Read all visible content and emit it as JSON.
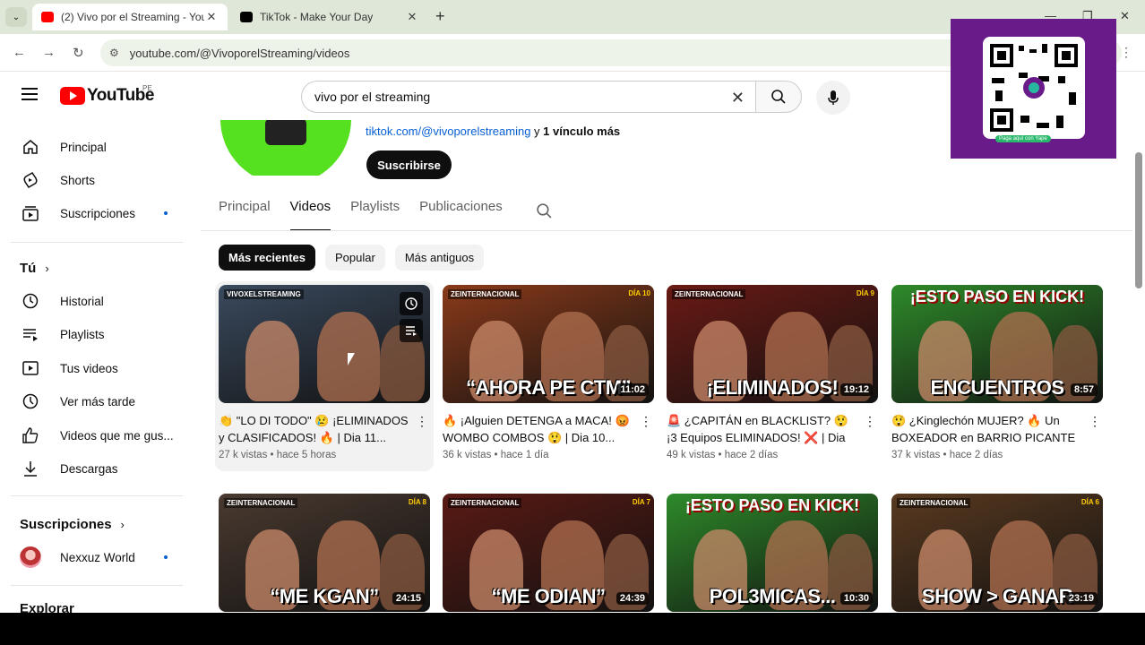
{
  "browser": {
    "tabs": [
      {
        "title": "(2) Vivo por el Streaming - YouT",
        "favicon_color": "#ff0000"
      },
      {
        "title": "TikTok - Make Your Day",
        "favicon_color": "#000000"
      }
    ],
    "url": "youtube.com/@VivoporelStreaming/videos"
  },
  "youtube": {
    "logo_text": "YouTube",
    "country": "PE",
    "search_value": "vivo por el streaming"
  },
  "sidebar": {
    "main": [
      {
        "label": "Principal",
        "icon": "home-icon"
      },
      {
        "label": "Shorts",
        "icon": "shorts-icon"
      },
      {
        "label": "Suscripciones",
        "icon": "subscriptions-icon"
      }
    ],
    "you_header": "Tú",
    "you": [
      {
        "label": "Historial",
        "icon": "history-icon"
      },
      {
        "label": "Playlists",
        "icon": "playlist-icon"
      },
      {
        "label": "Tus videos",
        "icon": "your-videos-icon"
      },
      {
        "label": "Ver más tarde",
        "icon": "watch-later-icon"
      },
      {
        "label": "Videos que me gus...",
        "icon": "like-icon"
      },
      {
        "label": "Descargas",
        "icon": "download-icon"
      }
    ],
    "subs_header": "Suscripciones",
    "subs": [
      {
        "label": "Nexxuz World"
      }
    ],
    "explore_header": "Explorar"
  },
  "channel": {
    "link": "tiktok.com/@vivoporelstreaming",
    "link_joiner": " y ",
    "more_links": "1 vínculo más",
    "subscribe_label": "Suscribirse",
    "tabs": [
      "Principal",
      "Videos",
      "Playlists",
      "Publicaciones"
    ],
    "active_tab": "Videos",
    "chips": [
      "Más recientes",
      "Popular",
      "Más antiguos"
    ]
  },
  "videos": [
    {
      "title": "👏 \"LO DI TODO\" 😢 ¡ELIMINADOS y CLASIFICADOS! 🔥 | Dia 11...",
      "views": "27 k vistas",
      "age": "hace 5 horas",
      "duration": "",
      "overlay": "",
      "brand": "VIVOXELSTREAMING",
      "day": "",
      "bg": "#3a4a5e"
    },
    {
      "title": "🔥 ¡Alguien DETENGA a MACA! 😡 WOMBO COMBOS 😲 | Dia 10...",
      "views": "36 k vistas",
      "age": "hace 1 día",
      "duration": "11:02",
      "overlay": "“AHORA PE CTM”",
      "brand": "ZEINTERNACIONAL",
      "day": "DÍA 10",
      "bg": "#8a3a1a"
    },
    {
      "title": "🚨 ¿CAPITÁN en BLACKLIST? 😲 ¡3 Equipos ELIMINADOS! ❌ | Dia 9...",
      "views": "49 k vistas",
      "age": "hace 2 días",
      "duration": "19:12",
      "overlay": "¡ELIMINADOS!",
      "brand": "ZEINTERNACIONAL",
      "day": "DÍA 9",
      "bg": "#6a1a14"
    },
    {
      "title": "😲 ¿Kinglechón MUJER? 🔥 Un BOXEADOR en BARRIO PICANTE ...",
      "views": "37 k vistas",
      "age": "hace 2 días",
      "duration": "8:57",
      "overlay": "ENCUENTROS",
      "brand": "¡ESTO PASO EN KICK!",
      "day": "",
      "bg": "#2e8a2a"
    },
    {
      "title": "",
      "views": "",
      "age": "",
      "duration": "24:15",
      "overlay": "“ME KGAN”",
      "brand": "ZEINTERNACIONAL",
      "day": "DÍA 8",
      "bg": "#4a3a30"
    },
    {
      "title": "",
      "views": "",
      "age": "",
      "duration": "24:39",
      "overlay": "“ME ODIAN”",
      "brand": "ZEINTERNACIONAL",
      "day": "DÍA 7",
      "bg": "#5a1a14"
    },
    {
      "title": "",
      "views": "",
      "age": "",
      "duration": "10:30",
      "overlay": "POL3MICAS...",
      "brand": "¡ESTO PASO EN KICK!",
      "day": "",
      "bg": "#2e8a2a"
    },
    {
      "title": "",
      "views": "",
      "age": "",
      "duration": "23:19",
      "overlay": "SHOW > GANAR",
      "brand": "ZEINTERNACIONAL",
      "day": "DÍA 6",
      "bg": "#5a3a20"
    }
  ],
  "qr": {
    "caption": "Paga aquí con Yape"
  },
  "colors": {
    "accent": "#ff0000",
    "link": "#065fd4",
    "qr_bg": "#6a1b8a"
  }
}
